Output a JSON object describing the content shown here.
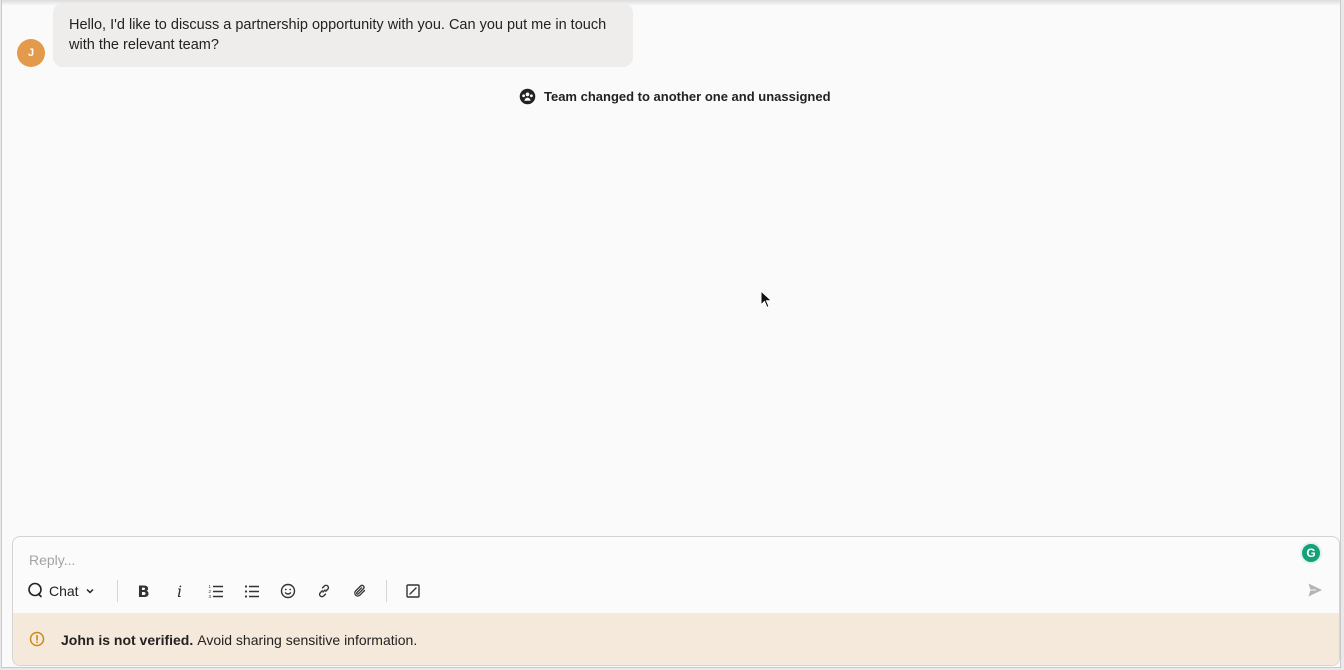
{
  "conversation": {
    "avatar_initial": "J",
    "message_text": "Hello, I'd like to discuss a partnership opportunity with you. Can you put me in touch with the relevant team?",
    "event_text": "Team changed to another one and unassigned",
    "event_icon": "team-icon"
  },
  "composer": {
    "reply_placeholder": "Reply...",
    "grammarly_label": "G",
    "mode_label": "Chat",
    "mode_icon": "chat-bubble-icon",
    "toolbar_icons": [
      "bold-icon",
      "italic-icon",
      "numbered-list-icon",
      "bulleted-list-icon",
      "emoji-icon",
      "link-icon",
      "attachment-icon",
      "canned-response-icon"
    ],
    "bold_glyph": "B",
    "italic_glyph": "i",
    "send_icon": "send-icon"
  },
  "warning": {
    "strong_text": "John is not verified.",
    "text": "Avoid sharing sensitive information.",
    "icon": "warning-icon",
    "background": "#f5e9dc",
    "icon_color": "#c98a1a"
  },
  "colors": {
    "avatar": "#e39a4a",
    "bubble": "#efedeb",
    "grammarly": "#15a07a"
  }
}
